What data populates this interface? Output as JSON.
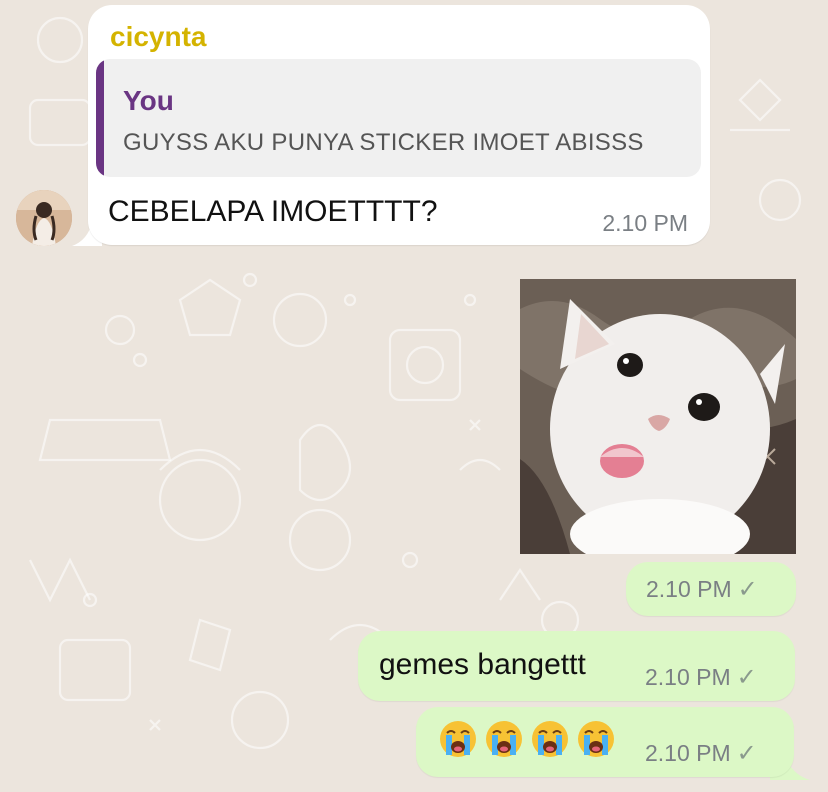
{
  "colors": {
    "sender_name": "#d4b300",
    "quote_accent": "#6a3583",
    "incoming_bubble": "#ffffff",
    "outgoing_bubble": "#dcf8c6",
    "chat_background": "#ece5dd"
  },
  "incoming_message": {
    "sender": "cicynta",
    "quoted": {
      "author": "You",
      "text": "GUYSS AKU PUNYA STICKER IMOET ABISSS"
    },
    "text": "CEBELAPA IMOETTTT?",
    "time": "2.10 PM"
  },
  "outgoing_messages": [
    {
      "type": "sticker",
      "image": "white-kitten-sticker",
      "time": "2.10 PM",
      "status_icon": "check-icon"
    },
    {
      "type": "text",
      "text": "gemes bangettt",
      "time": "2.10 PM",
      "status_icon": "check-icon"
    },
    {
      "type": "emoji",
      "emojis": [
        "😭",
        "😭",
        "😭",
        "😭"
      ],
      "time": "2.10 PM",
      "status_icon": "check-icon"
    }
  ],
  "status_check": "✓"
}
